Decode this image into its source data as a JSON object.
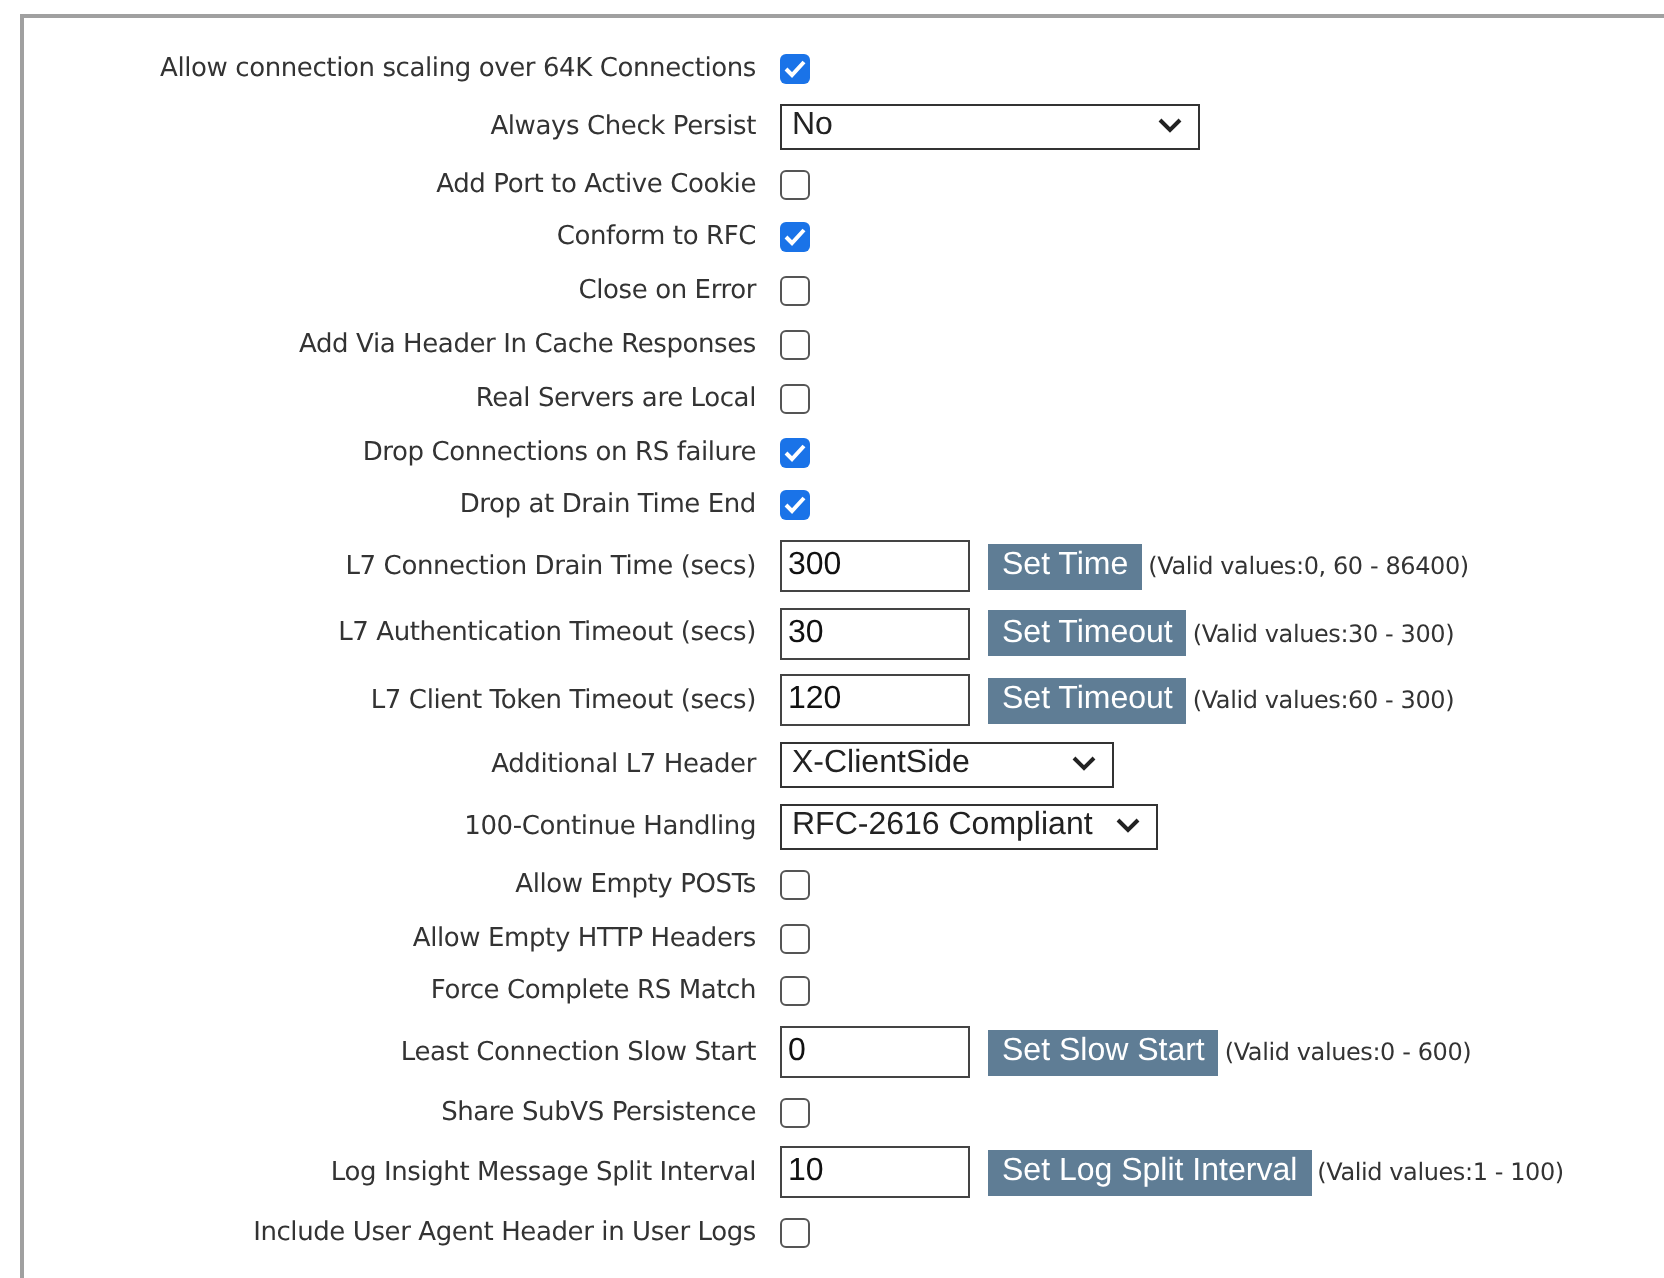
{
  "settings": [
    {
      "kind": "checkbox",
      "label": "Allow connection scaling over 64K Connections",
      "checked": true
    },
    {
      "kind": "select",
      "label": "Always Check Persist",
      "value": "No"
    },
    {
      "kind": "checkbox",
      "label": "Add Port to Active Cookie",
      "checked": false
    },
    {
      "kind": "checkbox",
      "label": "Conform to RFC",
      "checked": true
    },
    {
      "kind": "checkbox",
      "label": "Close on Error",
      "checked": false
    },
    {
      "kind": "checkbox",
      "label": "Add Via Header In Cache Responses",
      "checked": false
    },
    {
      "kind": "checkbox",
      "label": "Real Servers are Local",
      "checked": false
    },
    {
      "kind": "checkbox",
      "label": "Drop Connections on RS failure",
      "checked": true
    },
    {
      "kind": "checkbox",
      "label": "Drop at Drain Time End",
      "checked": true
    },
    {
      "kind": "input",
      "label": "L7 Connection Drain Time (secs)",
      "value": "300",
      "button": "Set Time",
      "hint": "(Valid values:0, 60 - 86400)"
    },
    {
      "kind": "input",
      "label": "L7 Authentication Timeout (secs)",
      "value": "30",
      "button": "Set Timeout",
      "hint": "(Valid values:30 - 300)"
    },
    {
      "kind": "input",
      "label": "L7 Client Token Timeout (secs)",
      "value": "120",
      "button": "Set Timeout",
      "hint": "(Valid values:60 - 300)"
    },
    {
      "kind": "select",
      "label": "Additional L7 Header",
      "value": "X-ClientSide"
    },
    {
      "kind": "select",
      "label": "100-Continue Handling",
      "value": "RFC-2616 Compliant"
    },
    {
      "kind": "checkbox",
      "label": "Allow Empty POSTs",
      "checked": false
    },
    {
      "kind": "checkbox",
      "label": "Allow Empty HTTP Headers",
      "checked": false
    },
    {
      "kind": "checkbox",
      "label": "Force Complete RS Match",
      "checked": false
    },
    {
      "kind": "input",
      "label": "Least Connection Slow Start",
      "value": "0",
      "button": "Set Slow Start",
      "hint": "(Valid values:0 - 600)"
    },
    {
      "kind": "checkbox",
      "label": "Share SubVS Persistence",
      "checked": false
    },
    {
      "kind": "input",
      "label": "Log Insight Message Split Interval",
      "value": "10",
      "button": "Set Log Split Interval",
      "hint": "(Valid values:1 - 100)"
    },
    {
      "kind": "checkbox",
      "label": "Include User Agent Header in User Logs",
      "checked": false
    }
  ]
}
